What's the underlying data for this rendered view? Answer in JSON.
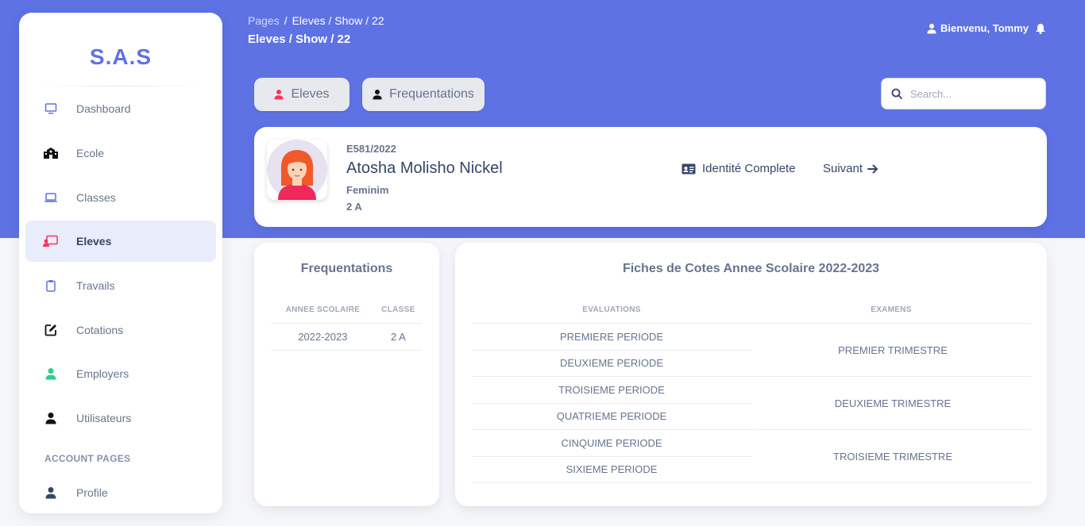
{
  "sidebar": {
    "brand": "S.A.S",
    "items": [
      {
        "label": "Dashboard",
        "icon": "monitor-icon"
      },
      {
        "label": "Ecole",
        "icon": "school-icon"
      },
      {
        "label": "Classes",
        "icon": "laptop-icon"
      },
      {
        "label": "Eleves",
        "icon": "student-board-icon",
        "active": true
      },
      {
        "label": "Travails",
        "icon": "clipboard-icon"
      },
      {
        "label": "Cotations",
        "icon": "edit-icon"
      },
      {
        "label": "Employers",
        "icon": "user-icon"
      },
      {
        "label": "Utilisateurs",
        "icon": "user-icon"
      }
    ],
    "section_account": "ACCOUNT PAGES",
    "profile_label": "Profile"
  },
  "header": {
    "breadcrumb_root": "Pages",
    "breadcrumb_sep": "/",
    "breadcrumb_current": "Eleves / Show / 22",
    "page_title": "Eleves / Show / 22",
    "user_greeting": "Bienvenu, Tommy"
  },
  "actions": {
    "eleves_label": "Eleves",
    "frequentations_label": "Frequentations",
    "search_placeholder": "Search..."
  },
  "student": {
    "matricule": "E581/2022",
    "name": "Atosha Molisho Nickel",
    "sexe": "Feminim",
    "classe": "2 A",
    "identite_label": "Identité Complete",
    "suivant_label": "Suivant"
  },
  "frequentations": {
    "title": "Frequentations",
    "columns": [
      "ANNEE SCOLAIRE",
      "CLASSE"
    ],
    "rows": [
      [
        "2022-2023",
        "2 A"
      ]
    ]
  },
  "fiches": {
    "title": "Fiches de Cotes Annee Scolaire 2022-2023",
    "columns": [
      "EVALUATIONS",
      "EXAMENS"
    ],
    "evaluations": [
      "PREMIERE PERIODE",
      "DEUXIEME PERIODE",
      "TROISIEME PERIODE",
      "QUATRIEME PERIODE",
      "CINQUIME PERIODE",
      "SIXIEME PERIODE"
    ],
    "examens": [
      "PREMIER TRIMESTRE",
      "DEUXIEME TRIMESTRE",
      "TROISIEME TRIMESTRE"
    ]
  },
  "colors": {
    "primary": "#5e72e4",
    "accent_red": "#f5365c",
    "accent_green": "#2dce89"
  }
}
